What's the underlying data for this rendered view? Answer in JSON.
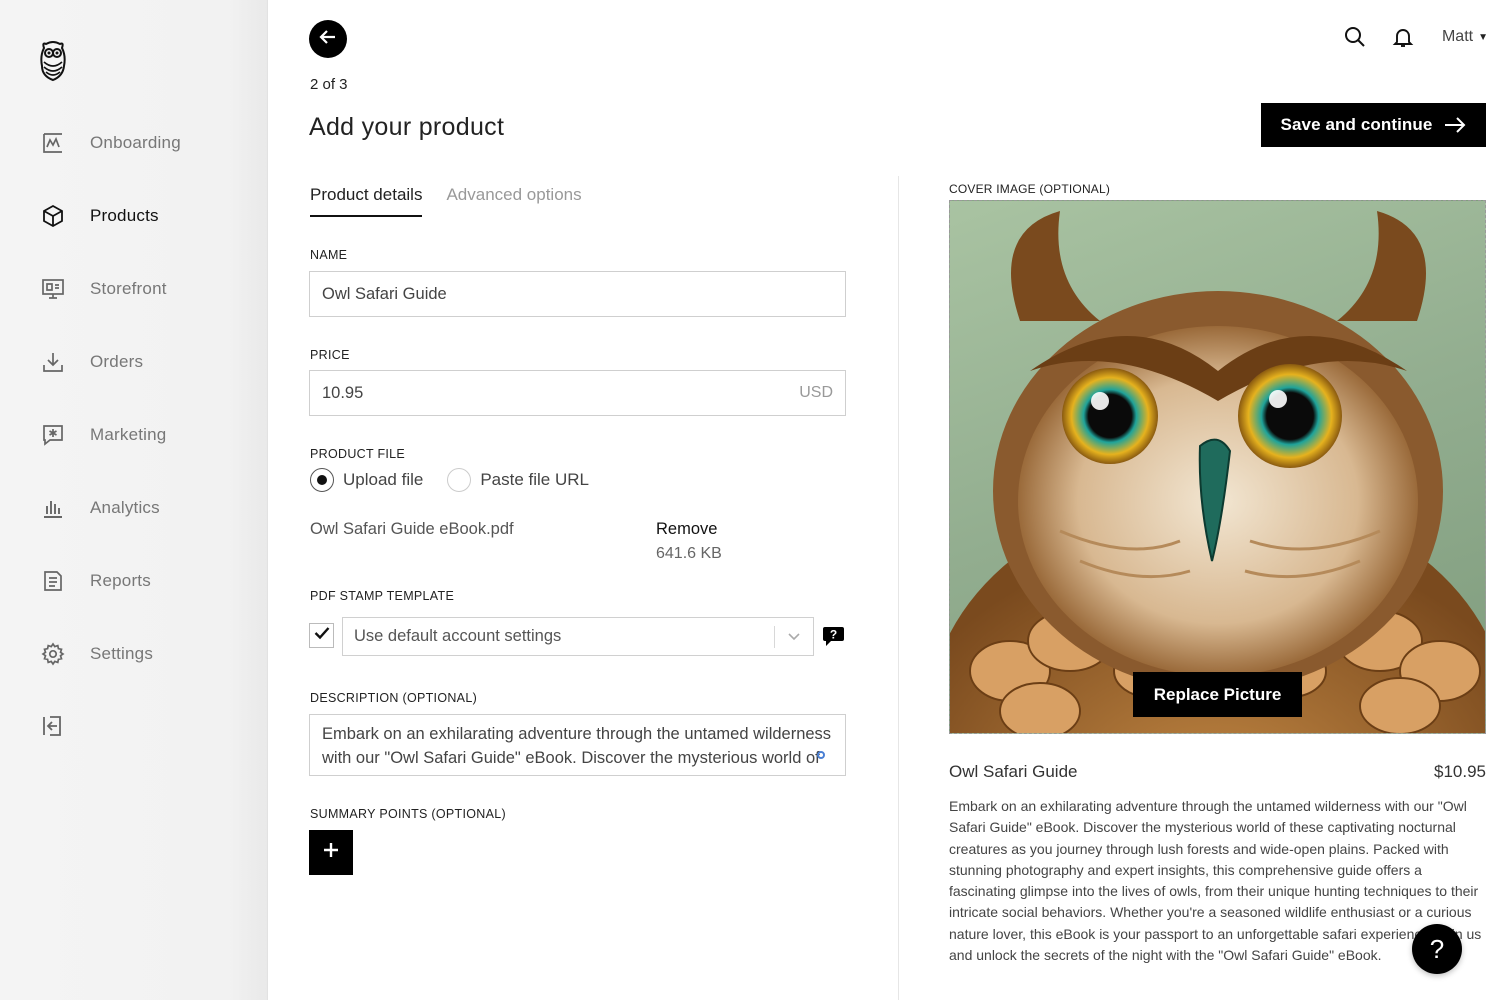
{
  "sidebar": {
    "logo_icon": "owl-logo-icon",
    "items": [
      {
        "label": "Onboarding",
        "icon": "chart-frame-icon",
        "active": false
      },
      {
        "label": "Products",
        "icon": "box-icon",
        "active": true
      },
      {
        "label": "Storefront",
        "icon": "monitor-icon",
        "active": false
      },
      {
        "label": "Orders",
        "icon": "download-tray-icon",
        "active": false
      },
      {
        "label": "Marketing",
        "icon": "megaphone-icon",
        "active": false
      },
      {
        "label": "Analytics",
        "icon": "bar-chart-icon",
        "active": false
      },
      {
        "label": "Reports",
        "icon": "document-icon",
        "active": false
      },
      {
        "label": "Settings",
        "icon": "gear-icon",
        "active": false
      }
    ],
    "logout_icon": "logout-icon"
  },
  "header": {
    "step": "2 of 3",
    "title": "Add your product",
    "user_name": "Matt",
    "save_label": "Save and continue"
  },
  "tabs": [
    {
      "label": "Product details",
      "active": true
    },
    {
      "label": "Advanced options",
      "active": false
    }
  ],
  "form": {
    "name_label": "NAME",
    "name_value": "Owl Safari Guide",
    "price_label": "PRICE",
    "price_value": "10.95",
    "price_currency": "USD",
    "file_label": "PRODUCT FILE",
    "file_options": [
      "Upload file",
      "Paste file URL"
    ],
    "file_selected": "Upload file",
    "file_name": "Owl Safari Guide eBook.pdf",
    "remove_label": "Remove",
    "file_size": "641.6 KB",
    "stamp_label": "PDF STAMP TEMPLATE",
    "stamp_checked": true,
    "stamp_value": "Use default account settings",
    "description_label": "DESCRIPTION (OPTIONAL)",
    "description_value": "Embark on an exhilarating adventure through the untamed wilderness with our \"Owl Safari Guide\" eBook. Discover the mysterious world of these captivating nocturnal creatures as you journey through lush forests and wide-open plains.",
    "summary_label": "SUMMARY POINTS (OPTIONAL)"
  },
  "preview": {
    "cover_label": "COVER IMAGE (OPTIONAL)",
    "replace_label": "Replace Picture",
    "title": "Owl Safari Guide",
    "price": "$10.95",
    "description": "Embark on an exhilarating adventure through the untamed wilderness with our \"Owl Safari Guide\" eBook. Discover the mysterious world of these captivating nocturnal creatures as you journey through lush forests and wide-open plains. Packed with stunning photography and expert insights, this comprehensive guide offers a fascinating glimpse into the lives of owls, from their unique hunting techniques to their intricate social behaviors. Whether you're a seasoned wildlife enthusiast or a curious nature lover, this eBook is your passport to an unforgettable safari experience. Join us and unlock the secrets of the night with the \"Owl Safari Guide\" eBook."
  },
  "help_label": "?",
  "colors": {
    "primary": "#000000",
    "text": "#222222",
    "muted": "#777777",
    "sidebar_bg": "#f3f3f3"
  }
}
